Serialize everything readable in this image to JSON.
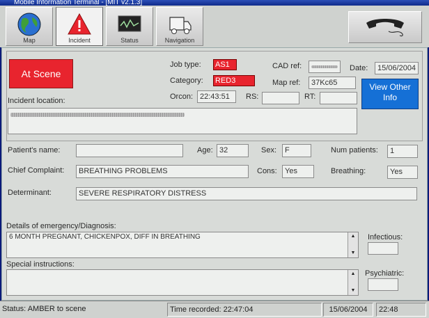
{
  "window": {
    "title": "Mobile Information Terminal - [MIT v2.1.3]"
  },
  "toolbar": {
    "tabs": [
      {
        "label": "Map",
        "icon": "globe-icon"
      },
      {
        "label": "Incident",
        "icon": "warning-triangle-icon"
      },
      {
        "label": "Status",
        "icon": "monitor-icon"
      },
      {
        "label": "Navigation",
        "icon": "vehicle-icon"
      }
    ],
    "active_tab": "Incident",
    "right_button_icon": "phone-handset-icon"
  },
  "incident": {
    "at_scene_label": "At Scene",
    "job_type_label": "Job type:",
    "job_type": "AS1",
    "category_label": "Category:",
    "category": "RED3",
    "cad_ref_label": "CAD ref:",
    "map_ref_label": "Map ref:",
    "map_ref": "37Kc65",
    "date_label": "Date:",
    "date": "15/06/2004",
    "orcon_label": "Orcon:",
    "orcon": "22:43:51",
    "rs_label": "RS:",
    "rt_label": "RT:",
    "view_other_info": "View Other Info",
    "location_label": "Incident location:"
  },
  "patient": {
    "name_label": "Patient's name:",
    "age_label": "Age:",
    "age": "32",
    "sex_label": "Sex:",
    "sex": "F",
    "num_patients_label": "Num patients:",
    "num_patients": "1",
    "chief_complaint_label": "Chief Complaint:",
    "chief_complaint": "BREATHING PROBLEMS",
    "cons_label": "Cons:",
    "cons": "Yes",
    "breathing_label": "Breathing:",
    "breathing": "Yes",
    "determinant_label": "Determinant:",
    "determinant": "SEVERE RESPIRATORY DISTRESS"
  },
  "details": {
    "label": "Details of emergency/Diagnosis:",
    "text": "6 MONTH PREGNANT, CHICKENPOX, DIFF IN BREATHING",
    "infectious_label": "Infectious:",
    "special_label": "Special instructions:",
    "psychiatric_label": "Psychiatric:"
  },
  "statusbar": {
    "status": "Status: AMBER to scene",
    "time_recorded": "Time recorded: 22:47:04",
    "date": "15/06/2004",
    "clock": "22:48"
  },
  "colors": {
    "accent_red": "#e8242e",
    "accent_blue": "#1570d6",
    "titlebar": "#0f2a8a"
  }
}
